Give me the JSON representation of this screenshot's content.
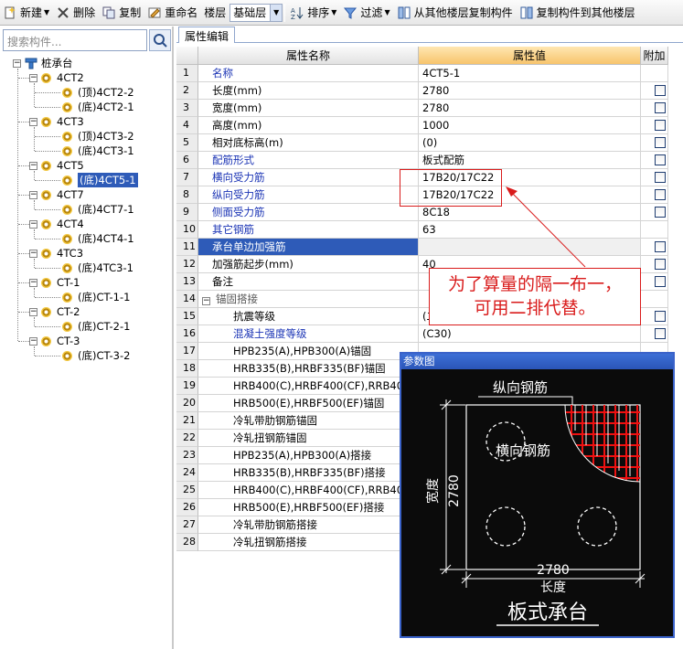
{
  "toolbar": {
    "new_label": "新建",
    "delete_label": "删除",
    "copy_label": "复制",
    "rename_label": "重命名",
    "floor_label": "楼层",
    "floor_value": "基础层",
    "sort_label": "排序",
    "filter_label": "过滤",
    "copy_from_floor_label": "从其他楼层复制构件",
    "copy_to_floor_label": "复制构件到其他楼层"
  },
  "search": {
    "placeholder": "搜索构件..."
  },
  "tree": {
    "root": "桩承台",
    "groups": [
      {
        "name": "4CT2",
        "children": [
          "(顶)4CT2-2",
          "(底)4CT2-1"
        ]
      },
      {
        "name": "4CT3",
        "children": [
          "(顶)4CT3-2",
          "(底)4CT3-1"
        ]
      },
      {
        "name": "4CT5",
        "children": [
          "(底)4CT5-1"
        ]
      },
      {
        "name": "4CT7",
        "children": [
          "(底)4CT7-1"
        ]
      },
      {
        "name": "4CT4",
        "children": [
          "(底)4CT4-1"
        ]
      },
      {
        "name": "4TC3",
        "children": [
          "(底)4TC3-1"
        ]
      },
      {
        "name": "CT-1",
        "children": [
          "(底)CT-1-1"
        ]
      },
      {
        "name": "CT-2",
        "children": [
          "(底)CT-2-1"
        ]
      },
      {
        "name": "CT-3",
        "children": [
          "(底)CT-3-2"
        ]
      }
    ]
  },
  "panel": {
    "tab": "属性编辑",
    "col_name": "属性名称",
    "col_value": "属性值",
    "col_attach": "附加"
  },
  "rows": [
    {
      "num": "1",
      "name": "名称",
      "value": "4CT5-1",
      "style": "blue",
      "check": false
    },
    {
      "num": "2",
      "name": "长度(mm)",
      "value": "2780",
      "style": "",
      "check": true
    },
    {
      "num": "3",
      "name": "宽度(mm)",
      "value": "2780",
      "style": "",
      "check": true
    },
    {
      "num": "4",
      "name": "高度(mm)",
      "value": "1000",
      "style": "",
      "check": true
    },
    {
      "num": "5",
      "name": "相对底标高(m)",
      "value": "(0)",
      "style": "",
      "check": true
    },
    {
      "num": "6",
      "name": "配筋形式",
      "value": "板式配筋",
      "style": "blue",
      "check": true
    },
    {
      "num": "7",
      "name": "横向受力筋",
      "value": "17B20/17C22",
      "style": "blue",
      "check": true
    },
    {
      "num": "8",
      "name": "纵向受力筋",
      "value": "17B20/17C22",
      "style": "blue",
      "check": true
    },
    {
      "num": "9",
      "name": "侧面受力筋",
      "value": "8C18",
      "style": "blue",
      "check": true
    },
    {
      "num": "10",
      "name": "其它钢筋",
      "value": "63",
      "style": "blue",
      "check": false
    },
    {
      "num": "11",
      "name": "承台单边加强筋",
      "value": "",
      "style": "hl",
      "check": true
    },
    {
      "num": "12",
      "name": "加强筋起步(mm)",
      "value": "40",
      "style": "",
      "check": true
    },
    {
      "num": "13",
      "name": "备注",
      "value": "",
      "style": "",
      "check": true
    },
    {
      "num": "14",
      "name": "锚固搭接",
      "value": "",
      "style": "group",
      "check": false
    },
    {
      "num": "15",
      "name": "抗震等级",
      "value": "(二级抗震)",
      "style": "sub",
      "check": true
    },
    {
      "num": "16",
      "name": "混凝土强度等级",
      "value": "(C30)",
      "style": "subblue",
      "check": true
    },
    {
      "num": "17",
      "name": "HPB235(A),HPB300(A)锚固",
      "value": "",
      "style": "sub",
      "check": false
    },
    {
      "num": "18",
      "name": "HRB335(B),HRBF335(BF)锚固",
      "value": "",
      "style": "sub",
      "check": false
    },
    {
      "num": "19",
      "name": "HRB400(C),HRBF400(CF),RRB400(D)锚固",
      "value": "",
      "style": "sub",
      "check": false
    },
    {
      "num": "20",
      "name": "HRB500(E),HRBF500(EF)锚固",
      "value": "",
      "style": "sub",
      "check": false
    },
    {
      "num": "21",
      "name": "冷轧带肋钢筋锚固",
      "value": "",
      "style": "sub",
      "check": false
    },
    {
      "num": "22",
      "name": "冷轧扭钢筋锚固",
      "value": "",
      "style": "sub",
      "check": false
    },
    {
      "num": "23",
      "name": "HPB235(A),HPB300(A)搭接",
      "value": "",
      "style": "sub",
      "check": false
    },
    {
      "num": "24",
      "name": "HRB335(B),HRBF335(BF)搭接",
      "value": "",
      "style": "sub",
      "check": false
    },
    {
      "num": "25",
      "name": "HRB400(C),HRBF400(CF),RRB400(D)搭接",
      "value": "",
      "style": "sub",
      "check": false
    },
    {
      "num": "26",
      "name": "HRB500(E),HRBF500(EF)搭接",
      "value": "",
      "style": "sub",
      "check": false
    },
    {
      "num": "27",
      "name": "冷轧带肋钢筋搭接",
      "value": "",
      "style": "sub",
      "check": false
    },
    {
      "num": "28",
      "name": "冷轧扭钢筋搭接",
      "value": "",
      "style": "sub",
      "check": false
    }
  ],
  "annotation": {
    "line1": "为了算量的隔一布一，",
    "line2": "可用二排代替。"
  },
  "param_window": {
    "title": "参数图",
    "label_longitudinal": "纵向钢筋",
    "label_transverse": "横向钢筋",
    "width_value": "2780",
    "width_label": "宽度",
    "length_value": "2780",
    "length_label": "长度",
    "caption": "板式承台"
  },
  "colors": {
    "selection": "#2e5bb8",
    "annotation": "#d91b1b",
    "header_value": "#f7c46c",
    "link_blue": "#1b34b5"
  }
}
